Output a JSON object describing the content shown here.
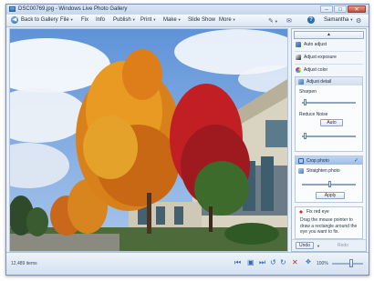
{
  "window": {
    "title": "DSC00769.jpg - Windows Live Photo Gallery",
    "minimize": "–",
    "maximize": "□",
    "close": "✕"
  },
  "menu": {
    "back_label": "Back to Gallery",
    "file": "File",
    "fix": "Fix",
    "info": "Info",
    "publish": "Publish",
    "print": "Print",
    "make": "Make",
    "slideshow": "Slide Show",
    "more": "More",
    "user": "Samantha",
    "help": "?"
  },
  "panel": {
    "auto_adjust": "Auto adjust",
    "adjust_exposure": "Adjust exposure",
    "adjust_color": "Adjust color",
    "adjust_detail": "Adjust detail",
    "sharpen": "Sharpen",
    "reduce_noise": "Reduce Noise",
    "auto_button": "Auto",
    "crop_photo": "Crop photo",
    "crop_check": "✓",
    "straighten_photo": "Straighten photo",
    "apply_button": "Apply",
    "fix_red_eye": "Fix red eye",
    "red_eye_instructions": "Drag the mouse pointer to draw a rectangle around the eye you want to fix.",
    "undo": "Undo",
    "redo": "Redo",
    "sharpen_level": 0.05,
    "noise_level": 0.05,
    "straighten_level": 0.5
  },
  "status": {
    "count": "12,489 items",
    "zoom": "100%",
    "zoom_level": 0.6
  },
  "colors": {
    "accent": "#2b6cb5",
    "delete": "#c02a1e"
  }
}
